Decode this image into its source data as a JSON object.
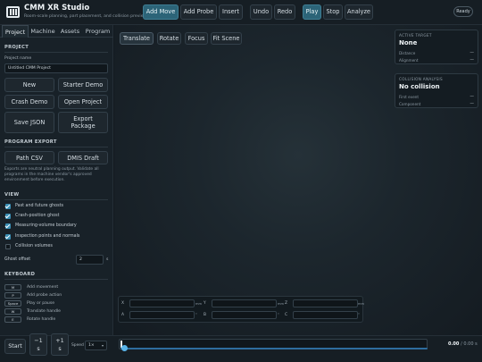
{
  "header": {
    "title": "CMM XR Studio",
    "subtitle": "Room-scale planning, part placement, and collision preview",
    "buttons": {
      "add_move": "Add Move",
      "add_probe": "Add Probe",
      "insert": "Insert",
      "undo": "Undo",
      "redo": "Redo",
      "play": "Play",
      "stop": "Stop",
      "analyze": "Analyze"
    },
    "status": "Ready"
  },
  "tabs": [
    "Project",
    "Machine",
    "Assets",
    "Program"
  ],
  "project": {
    "section": "PROJECT",
    "name_label": "Project name",
    "name_value": "Untitled CMM Project",
    "buttons": {
      "new": "New",
      "starter_demo": "Starter Demo",
      "crash_demo": "Crash Demo",
      "open_project": "Open Project",
      "save_json": "Save JSON",
      "export_package": "Export Package"
    }
  },
  "program_export": {
    "section": "PROGRAM EXPORT",
    "path_csv": "Path CSV",
    "dmis_draft": "DMIS Draft",
    "note": "Exports are neutral planning output. Validate all programs in the machine vendor's approved environment before execution."
  },
  "view": {
    "section": "VIEW",
    "options": [
      {
        "label": "Past and future ghosts",
        "checked": true
      },
      {
        "label": "Crash-position ghost",
        "checked": true
      },
      {
        "label": "Measuring-volume boundary",
        "checked": true
      },
      {
        "label": "Inspection points and normals",
        "checked": true
      },
      {
        "label": "Collision volumes",
        "checked": false
      }
    ],
    "ghost_offset_label": "Ghost offset",
    "ghost_offset_value": "2",
    "ghost_offset_unit": "s"
  },
  "keyboard": {
    "section": "KEYBOARD",
    "shortcuts": [
      {
        "key": "M",
        "desc": "Add movement"
      },
      {
        "key": "P",
        "desc": "Add probe action"
      },
      {
        "key": "Space",
        "desc": "Play or pause"
      },
      {
        "key": "W",
        "desc": "Translate handle"
      },
      {
        "key": "E",
        "desc": "Rotate handle"
      }
    ]
  },
  "viewport": {
    "tools": [
      "Translate",
      "Rotate",
      "Focus",
      "Fit Scene"
    ],
    "active_tool": "Translate",
    "active_target": {
      "title": "ACTIVE TARGET",
      "value": "None",
      "rows": [
        {
          "k": "Distance",
          "v": "—"
        },
        {
          "k": "Alignment",
          "v": "—"
        }
      ]
    },
    "collision": {
      "title": "COLLISION ANALYSIS",
      "value": "No collision",
      "rows": [
        {
          "k": "First event",
          "v": "—"
        },
        {
          "k": "Component",
          "v": "—"
        }
      ]
    },
    "coords": {
      "x": "X",
      "y": "Y",
      "z": "Z",
      "a": "A",
      "b": "B",
      "c": "C",
      "unit_mm": "mm",
      "unit_deg": "°"
    }
  },
  "playback": {
    "start": "Start",
    "back": "−1",
    "back_unit": "s",
    "fwd": "+1",
    "fwd_unit": "s",
    "speed_label": "Speed",
    "speed_value": "1×",
    "progress": 0,
    "time_current": "0.00",
    "time_total": "/ 0.00 s"
  }
}
